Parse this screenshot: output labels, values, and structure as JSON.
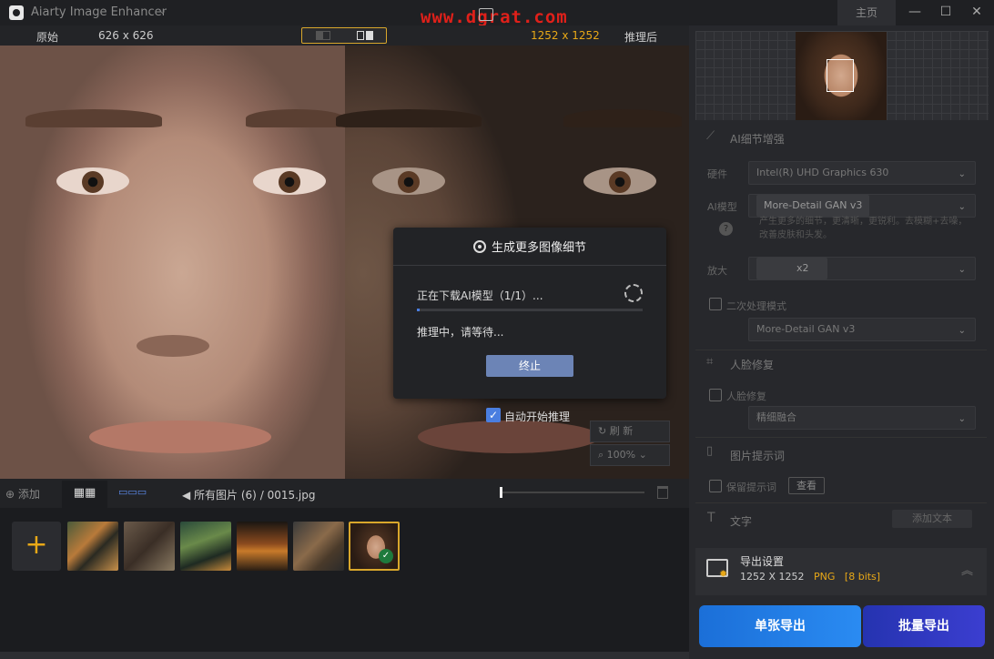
{
  "app": {
    "title": "Aiarty Image Enhancer",
    "watermark": "www.dgrat.com",
    "home_label": "主页"
  },
  "window_controls": {
    "minimize": "—",
    "maximize": "☐",
    "close": "✕"
  },
  "compare": {
    "original_label": "原始",
    "original_size": "626 x 626",
    "output_size": "1252 x 1252",
    "after_label": "推理后"
  },
  "dialog": {
    "title": "生成更多图像细节",
    "status": "正在下载AI模型（1/1）...",
    "progress": 0.01,
    "sub_status": "推理中，请等待...",
    "stop_label": "终止",
    "auto_label": "自动开始推理"
  },
  "tools": {
    "refresh": "刷 新",
    "zoom": "100%"
  },
  "toolbar": {
    "add_label": "添加",
    "breadcrumb_all": "所有图片 (6)",
    "breadcrumb_sep": "/",
    "breadcrumb_file": "0015.jpg"
  },
  "panel": {
    "detail_title": "AI细节增强",
    "hardware_label": "硬件",
    "hardware_value": "Intel(R) UHD Graphics 630",
    "model_label": "AI模型",
    "model_value": "More-Detail GAN  v3",
    "model_desc": "产生更多的细节，更清晰，更锐利。去模糊+去噪，改善皮肤和头发。",
    "scale_label": "放大",
    "scale_value": "x2",
    "second_pass_label": "二次处理模式",
    "second_pass_value": "More-Detail GAN  v3",
    "face_title": "人脸修复",
    "face_chk_label": "人脸修复",
    "face_value": "精细融合",
    "prompt_title": "图片提示词",
    "keep_prompt_label": "保留提示词",
    "view_label": "查看",
    "text_title": "文字",
    "add_text_label": "添加文本"
  },
  "export": {
    "title": "导出设置",
    "size": "1252 X 1252",
    "format": "PNG",
    "bits": "[8 bits]",
    "single_label": "单张导出",
    "batch_label": "批量导出"
  },
  "colors": {
    "accent": "#e8a817",
    "primary_blue": "#2a8bf2",
    "batch_purple": "#3b3ed0"
  }
}
